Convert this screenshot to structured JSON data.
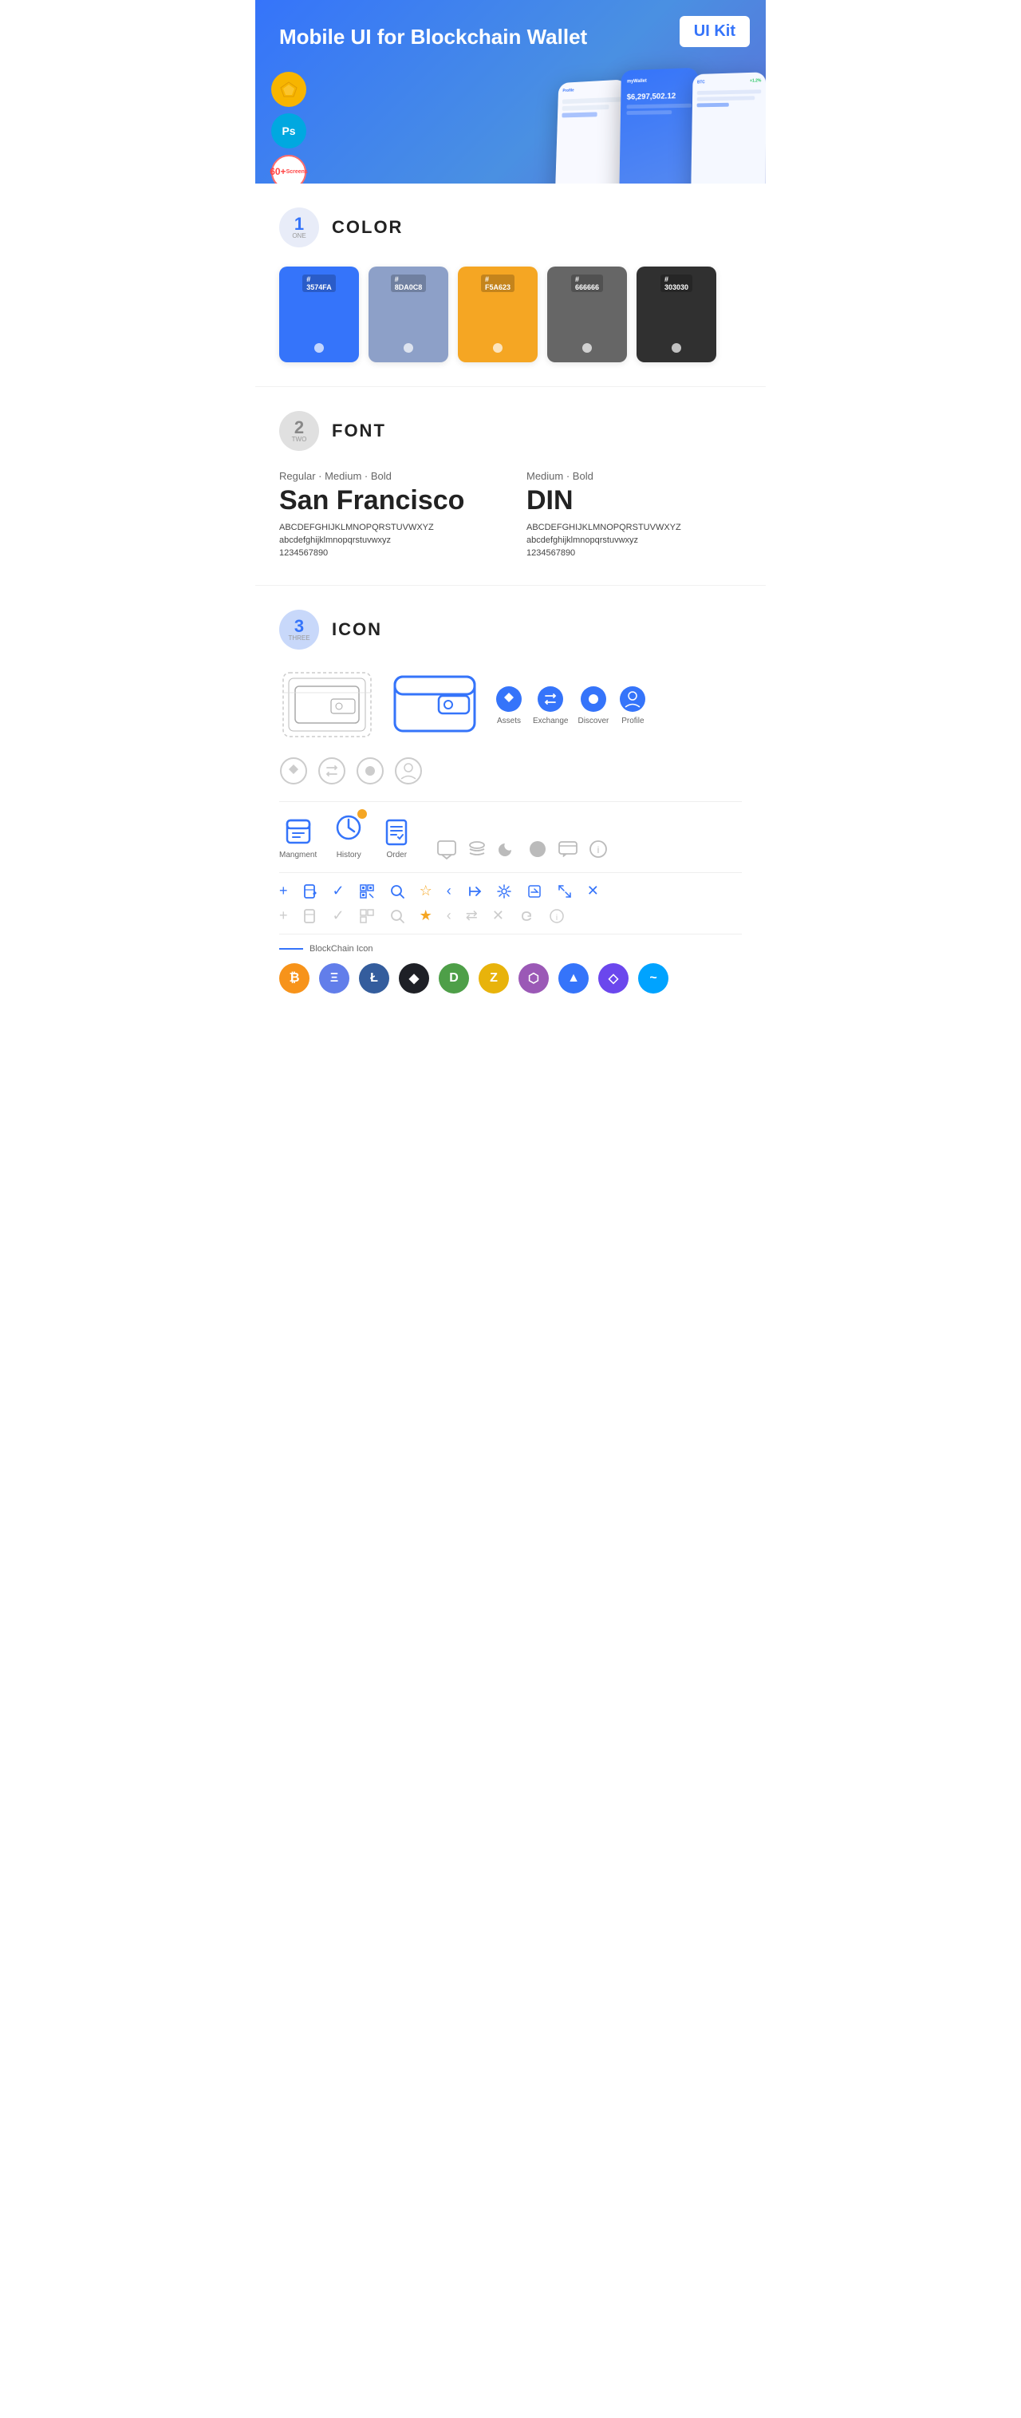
{
  "hero": {
    "title": "Mobile UI for Blockchain ",
    "title_bold": "Wallet",
    "badge": "UI Kit",
    "badges": [
      {
        "id": "sketch",
        "symbol": "◈",
        "color": "#F7B500"
      },
      {
        "id": "ps",
        "symbol": "Ps",
        "color": "#00A8E0"
      },
      {
        "id": "screens",
        "line1": "60+",
        "line2": "Screens",
        "color": "#fff"
      }
    ]
  },
  "section_color": {
    "number": "1",
    "sub": "ONE",
    "title": "COLOR",
    "swatches": [
      {
        "hex": "#3574FA",
        "label": "3574FA"
      },
      {
        "hex": "#8DA0C8",
        "label": "8DA0C8"
      },
      {
        "hex": "#F5A623",
        "label": "F5A623"
      },
      {
        "hex": "#666666",
        "label": "666666"
      },
      {
        "hex": "#303030",
        "label": "303030"
      }
    ]
  },
  "section_font": {
    "number": "2",
    "sub": "TWO",
    "title": "FONT",
    "fonts": [
      {
        "style": "Regular · Medium · Bold",
        "name": "San Francisco",
        "uppercase": "ABCDEFGHIJKLMNOPQRSTUVWXYZ",
        "lowercase": "abcdefghijklmnopqrstuvwxyz",
        "numbers": "1234567890"
      },
      {
        "style": "Medium · Bold",
        "name": "DIN",
        "uppercase": "ABCDEFGHIJKLMNOPQRSTUVWXYZ",
        "lowercase": "abcdefghijklmnopqrstuvwxyz",
        "numbers": "1234567890"
      }
    ]
  },
  "section_icon": {
    "number": "3",
    "sub": "THREE",
    "title": "ICON",
    "tab_icons": [
      {
        "label": "Assets",
        "color": "#3574FA"
      },
      {
        "label": "Exchange",
        "color": "#3574FA"
      },
      {
        "label": "Discover",
        "color": "#3574FA"
      },
      {
        "label": "Profile",
        "color": "#3574FA"
      }
    ],
    "nav_icons": [
      {
        "label": "Mangment"
      },
      {
        "label": "History"
      },
      {
        "label": "Order"
      }
    ],
    "blockchain_label": "BlockChain Icon",
    "crypto_coins": [
      {
        "symbol": "₿",
        "bg": "#F7931A",
        "name": "Bitcoin"
      },
      {
        "symbol": "Ξ",
        "bg": "#627EEA",
        "name": "Ethereum"
      },
      {
        "symbol": "Ł",
        "bg": "#345D9D",
        "name": "Litecoin"
      },
      {
        "symbol": "◆",
        "bg": "#1E2026",
        "name": "BlackCoin"
      },
      {
        "symbol": "D",
        "bg": "#4E9F48",
        "name": "Dash"
      },
      {
        "symbol": "Z",
        "bg": "#E8B30B",
        "name": "Zcash"
      },
      {
        "symbol": "⬡",
        "bg": "#9B59B6",
        "name": "Grid"
      },
      {
        "symbol": "▲",
        "bg": "#3574FA",
        "name": "Waves"
      },
      {
        "symbol": "◆",
        "bg": "#6B47ED",
        "name": "Qtum"
      },
      {
        "symbol": "~",
        "bg": "#00A3FF",
        "name": "Matic"
      }
    ]
  },
  "accent_color": "#3574FA"
}
